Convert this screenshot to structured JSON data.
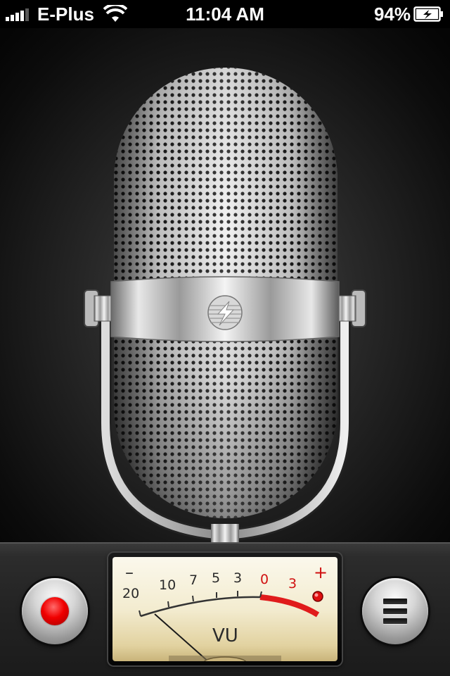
{
  "status_bar": {
    "carrier": "E-Plus",
    "time": "11:04 AM",
    "battery_percent": "94%",
    "signal_icon": "signal-bars-icon",
    "wifi_icon": "wifi-icon",
    "battery_icon": "battery-charging-icon"
  },
  "microphone": {
    "icon": "microphone-icon",
    "badge_icon": "lightning-logo-icon"
  },
  "controls": {
    "record_icon": "record-icon",
    "list_icon": "list-icon"
  },
  "vu_meter": {
    "scale_labels": [
      "20",
      "10",
      "7",
      "5",
      "3",
      "0",
      "3"
    ],
    "minus_label": "–",
    "plus_label": "+",
    "unit_label": "VU",
    "needle_level_db": -20,
    "colors": {
      "red_zone": "#e01b1b",
      "peak_led": "#e01010",
      "record_dot": "#f00000"
    }
  }
}
